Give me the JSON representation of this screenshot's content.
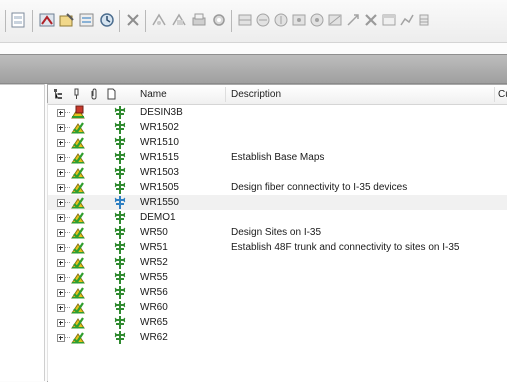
{
  "toolbar": {
    "icons": [
      "document-icon",
      "save-icon",
      "find-icon",
      "edit-icon",
      "properties-icon",
      "refresh-icon",
      "delete-icon",
      "cut-icon",
      "copy-icon",
      "print-icon",
      "settings-icon",
      "layer-1-icon",
      "layer-2-icon",
      "layer-3-icon",
      "layer-4-icon",
      "layer-5-icon",
      "layer-6-icon",
      "layer-7-icon",
      "close-x-icon",
      "window-icon",
      "chart-icon",
      "table-icon"
    ]
  },
  "table": {
    "headers": {
      "col1_icon": "structure-icon",
      "col2_icon": "pin-icon",
      "col3_icon": "attachment-icon",
      "col4_icon": "document-icon",
      "name": "Name",
      "description": "Description",
      "cut_off": "Cu"
    },
    "rows": [
      {
        "name": "DESIN3B",
        "description": "",
        "status": "building"
      },
      {
        "name": "WR1502",
        "description": "",
        "status": "ok"
      },
      {
        "name": "WR1510",
        "description": "",
        "status": "ok"
      },
      {
        "name": "WR1515",
        "description": "Establish Base Maps",
        "status": "ok"
      },
      {
        "name": "WR1503",
        "description": "",
        "status": "ok"
      },
      {
        "name": "WR1505",
        "description": "Design fiber connectivity to I-35 devices",
        "status": "ok"
      },
      {
        "name": "WR1550",
        "description": "",
        "status": "ok",
        "selected": true
      },
      {
        "name": "DEMO1",
        "description": "",
        "status": "ok"
      },
      {
        "name": "WR50",
        "description": "Design Sites on I-35",
        "status": "ok"
      },
      {
        "name": "WR51",
        "description": "Establish 48F trunk and connectivity to sites on I-35",
        "status": "ok"
      },
      {
        "name": "WR52",
        "description": "",
        "status": "ok"
      },
      {
        "name": "WR55",
        "description": "",
        "status": "ok"
      },
      {
        "name": "WR56",
        "description": "",
        "status": "ok"
      },
      {
        "name": "WR60",
        "description": "",
        "status": "ok"
      },
      {
        "name": "WR65",
        "description": "",
        "status": "ok"
      },
      {
        "name": "WR62",
        "description": "",
        "status": "ok"
      }
    ]
  },
  "colors": {
    "graybar": "#a8a8a8",
    "icon_green": "#2f9e2f",
    "icon_yellow": "#e5c21a",
    "icon_red": "#c8392b",
    "selected_row": "#f1f1f1"
  }
}
